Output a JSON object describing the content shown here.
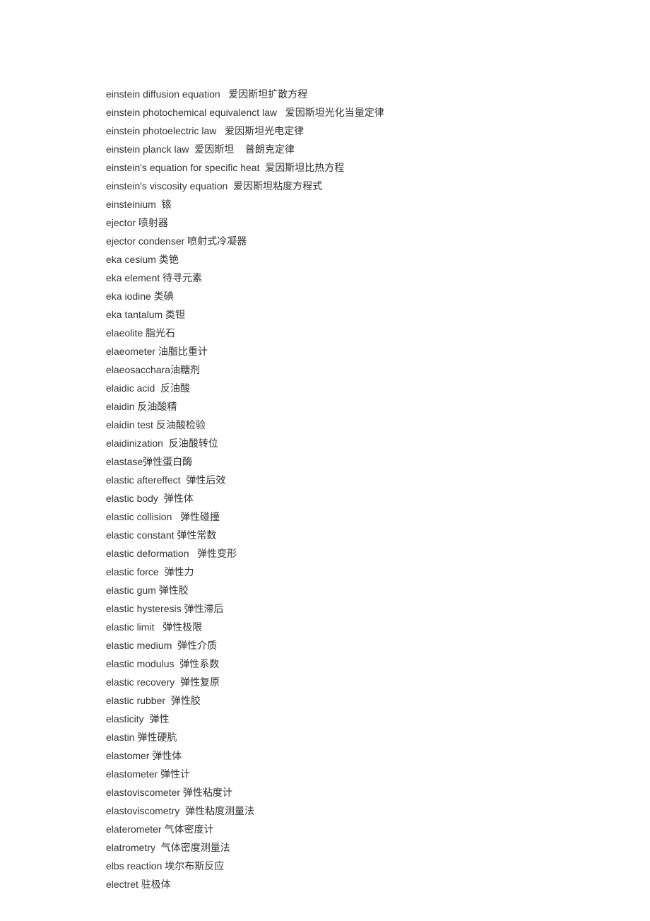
{
  "entries": [
    {
      "en": "einstein diffusion equation",
      "sep": "   ",
      "zh": "爱因斯坦扩散方程"
    },
    {
      "en": "einstein photochemical equivalenct law",
      "sep": "   ",
      "zh": "爱因斯坦光化当量定律"
    },
    {
      "en": "einstein photoelectric law",
      "sep": "   ",
      "zh": "爱因斯坦光电定律"
    },
    {
      "en": "einstein planck law",
      "sep": "  ",
      "zh": "爱因斯坦    普朗克定律"
    },
    {
      "en": "einstein's equation for specific heat",
      "sep": "  ",
      "zh": "爱因斯坦比热方程"
    },
    {
      "en": "einstein's viscosity equation",
      "sep": "  ",
      "zh": "爱因斯坦粘度方程式"
    },
    {
      "en": "einsteinium",
      "sep": "  ",
      "zh": "锿"
    },
    {
      "en": "ejector",
      "sep": " ",
      "zh": "喷射器"
    },
    {
      "en": "ejector condenser",
      "sep": " ",
      "zh": "喷射式冷凝器"
    },
    {
      "en": "eka cesium",
      "sep": " ",
      "zh": "类铯"
    },
    {
      "en": "eka element",
      "sep": " ",
      "zh": "待寻元素"
    },
    {
      "en": "eka iodine",
      "sep": " ",
      "zh": "类碘"
    },
    {
      "en": "eka tantalum",
      "sep": " ",
      "zh": "类钽"
    },
    {
      "en": "elaeolite",
      "sep": " ",
      "zh": "脂光石"
    },
    {
      "en": "elaeometer",
      "sep": " ",
      "zh": "油脂比重计"
    },
    {
      "en": "elaeosacchara",
      "sep": "",
      "zh": "油糖剂"
    },
    {
      "en": "elaidic acid",
      "sep": "  ",
      "zh": "反油酸"
    },
    {
      "en": "elaidin",
      "sep": " ",
      "zh": "反油酸精"
    },
    {
      "en": "elaidin test",
      "sep": " ",
      "zh": "反油酸检验"
    },
    {
      "en": "elaidinization",
      "sep": "  ",
      "zh": "反油酸转位"
    },
    {
      "en": "elastase",
      "sep": "",
      "zh": "弹性蛋白酶"
    },
    {
      "en": "elastic aftereffect",
      "sep": "  ",
      "zh": "弹性后效"
    },
    {
      "en": "elastic body",
      "sep": "  ",
      "zh": "弹性体"
    },
    {
      "en": "elastic collision",
      "sep": "   ",
      "zh": "弹性碰撞"
    },
    {
      "en": "elastic constant",
      "sep": " ",
      "zh": "弹性常数"
    },
    {
      "en": "elastic deformation",
      "sep": "   ",
      "zh": "弹性变形"
    },
    {
      "en": "elastic force",
      "sep": "  ",
      "zh": "弹性力"
    },
    {
      "en": "elastic gum",
      "sep": " ",
      "zh": "弹性胶"
    },
    {
      "en": "elastic hysteresis",
      "sep": " ",
      "zh": "弹性滞后"
    },
    {
      "en": "elastic limit",
      "sep": "   ",
      "zh": "弹性极限"
    },
    {
      "en": "elastic medium",
      "sep": "  ",
      "zh": "弹性介质"
    },
    {
      "en": "elastic modulus",
      "sep": "  ",
      "zh": "弹性系数"
    },
    {
      "en": "elastic recovery",
      "sep": "  ",
      "zh": "弹性复原"
    },
    {
      "en": "elastic rubber",
      "sep": "  ",
      "zh": "弹性胶"
    },
    {
      "en": "elasticity",
      "sep": "  ",
      "zh": "弹性"
    },
    {
      "en": "elastin",
      "sep": " ",
      "zh": "弹性硬肮"
    },
    {
      "en": "elastomer",
      "sep": " ",
      "zh": "弹性体"
    },
    {
      "en": "elastometer",
      "sep": " ",
      "zh": "弹性计"
    },
    {
      "en": "elastoviscometer",
      "sep": " ",
      "zh": "弹性粘度计"
    },
    {
      "en": "elastoviscometry",
      "sep": "  ",
      "zh": "弹性粘度测量法"
    },
    {
      "en": "elaterometer",
      "sep": " ",
      "zh": "气体密度计"
    },
    {
      "en": "elatrometry",
      "sep": "  ",
      "zh": "气体密度测量法"
    },
    {
      "en": "elbs reaction",
      "sep": " ",
      "zh": "埃尔布斯反应"
    },
    {
      "en": "electret",
      "sep": " ",
      "zh": "驻极体"
    }
  ]
}
